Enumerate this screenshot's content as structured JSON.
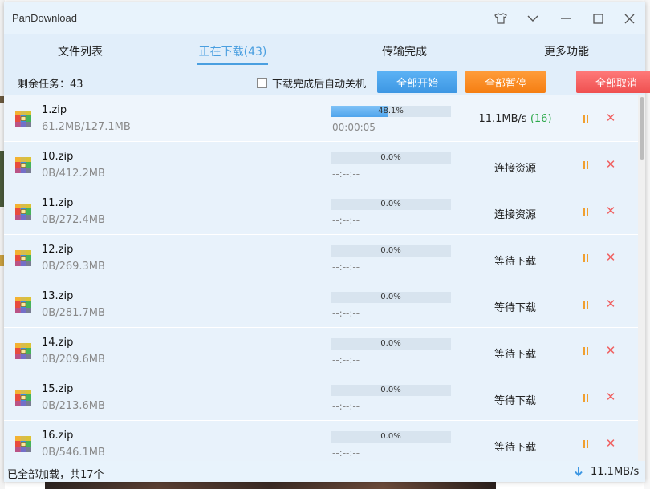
{
  "window": {
    "title": "PanDownload"
  },
  "tabs": [
    {
      "label": "文件列表"
    },
    {
      "label": "正在下载(43)"
    },
    {
      "label": "传输完成"
    },
    {
      "label": "更多功能"
    }
  ],
  "toolbar": {
    "remaining": "剩余任务：43",
    "auto_shutdown_label": "下载完成后自动关机",
    "start_all": "全部开始",
    "pause_all": "全部暂停",
    "cancel_all": "全部取消"
  },
  "downloads": [
    {
      "name": "1.zip",
      "size": "61.2MB/127.1MB",
      "percent": "48.1%",
      "progress": 0.481,
      "time": "00:00:05",
      "speed": "11.1MB/s",
      "connections": "(16)",
      "status": ""
    },
    {
      "name": "10.zip",
      "size": "0B/412.2MB",
      "percent": "0.0%",
      "progress": 0,
      "time": "--:--:--",
      "status": "连接资源"
    },
    {
      "name": "11.zip",
      "size": "0B/272.4MB",
      "percent": "0.0%",
      "progress": 0,
      "time": "--:--:--",
      "status": "连接资源"
    },
    {
      "name": "12.zip",
      "size": "0B/269.3MB",
      "percent": "0.0%",
      "progress": 0,
      "time": "--:--:--",
      "status": "等待下载"
    },
    {
      "name": "13.zip",
      "size": "0B/281.7MB",
      "percent": "0.0%",
      "progress": 0,
      "time": "--:--:--",
      "status": "等待下载"
    },
    {
      "name": "14.zip",
      "size": "0B/209.6MB",
      "percent": "0.0%",
      "progress": 0,
      "time": "--:--:--",
      "status": "等待下载"
    },
    {
      "name": "15.zip",
      "size": "0B/213.6MB",
      "percent": "0.0%",
      "progress": 0,
      "time": "--:--:--",
      "status": "等待下载"
    },
    {
      "name": "16.zip",
      "size": "0B/546.1MB",
      "percent": "0.0%",
      "progress": 0,
      "time": "--:--:--",
      "status": "等待下载"
    }
  ],
  "statusbar": {
    "loaded_text": "已全部加载，共17个",
    "total_speed": "11.1MB/s"
  },
  "colors": {
    "accent": "#4a9fe0",
    "start": "#3d97e3",
    "pause": "#f57e12",
    "cancel": "#ef5050",
    "connections": "#2da84a",
    "pause_icon": "#f0a030",
    "close_icon": "#f06060"
  },
  "icons": {
    "file": "zip-archive-icon",
    "row_pause": "pause-icon",
    "row_cancel": "close-icon",
    "statusbar": "download-arrow-icon"
  }
}
